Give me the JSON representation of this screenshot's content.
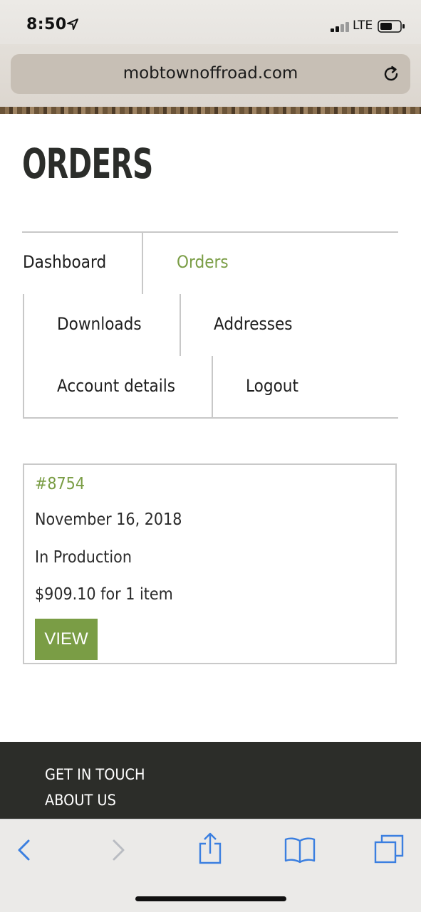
{
  "status_bar": {
    "time": "8:50",
    "network": "LTE",
    "icons": [
      "location-arrow-icon",
      "signal-bars-icon",
      "battery-icon"
    ]
  },
  "browser": {
    "url": "mobtownoffroad.com",
    "icons": [
      "reload-icon",
      "back-icon",
      "forward-icon",
      "share-icon",
      "bookmarks-icon",
      "tabs-icon"
    ]
  },
  "page": {
    "title": "ORDERS"
  },
  "account_nav": {
    "items": [
      {
        "label": "Dashboard",
        "active": false
      },
      {
        "label": "Orders",
        "active": true
      },
      {
        "label": "Downloads",
        "active": false
      },
      {
        "label": "Addresses",
        "active": false
      },
      {
        "label": "Account details",
        "active": false
      },
      {
        "label": "Logout",
        "active": false
      }
    ]
  },
  "orders": [
    {
      "number": "#8754",
      "date": "November 16, 2018",
      "status": "In Production",
      "total": "$909.10 for 1 item",
      "action_label": "VIEW"
    }
  ],
  "footer": {
    "links": [
      "GET IN TOUCH",
      "ABOUT US"
    ]
  },
  "colors": {
    "accent": "#7a9d45",
    "footer_bg": "#2c2d29",
    "ios_blue": "#3b7fe0"
  }
}
